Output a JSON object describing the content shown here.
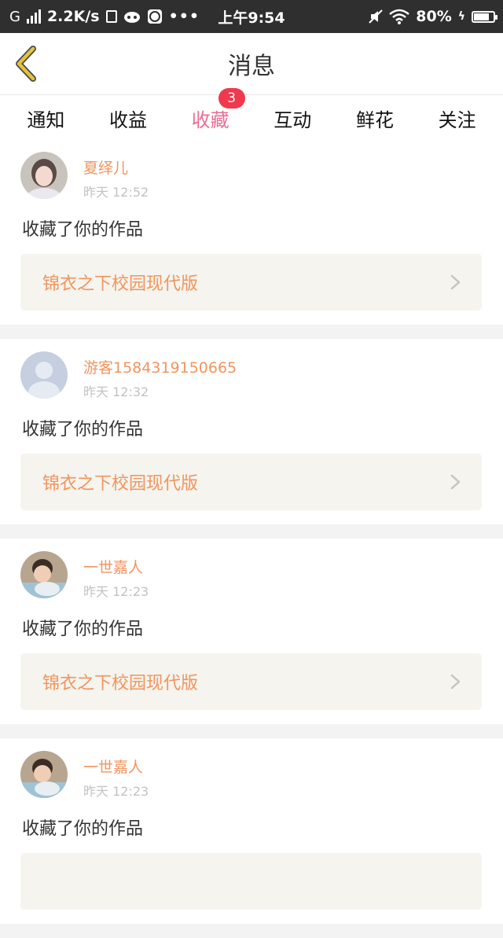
{
  "status_bar": {
    "network_type": "G",
    "speed": "2.2K/s",
    "time": "上午9:54",
    "battery": "80%",
    "battery_level": 0.8,
    "icons": [
      "signal-icon",
      "sim-icon",
      "cat-icon",
      "globe-icon",
      "more-icon",
      "mute-icon",
      "wifi-icon",
      "battery-icon"
    ]
  },
  "header": {
    "title": "消息",
    "back_icon": "chevron-left-icon",
    "accent": "#e6c23a"
  },
  "tabs": [
    {
      "label": "通知",
      "active": false
    },
    {
      "label": "收益",
      "active": false
    },
    {
      "label": "收藏",
      "active": true,
      "badge": "3"
    },
    {
      "label": "互动",
      "active": false
    },
    {
      "label": "鲜花",
      "active": false
    },
    {
      "label": "关注",
      "active": false
    }
  ],
  "colors": {
    "active_tab": "#ea6d94",
    "badge": "#f0394d",
    "username": "#f0955e",
    "work_title": "#f0955e",
    "work_box_bg": "#f5f4ee"
  },
  "feed": [
    {
      "username": "夏绎儿",
      "time": "昨天 12:52",
      "action": "收藏了你的作品",
      "work_title": "锦衣之下校园现代版",
      "avatar": "avatar-woman"
    },
    {
      "username": "游客1584319150665",
      "time": "昨天 12:32",
      "action": "收藏了你的作品",
      "work_title": "锦衣之下校园现代版",
      "avatar": "avatar-default"
    },
    {
      "username": "一世嘉人",
      "time": "昨天 12:23",
      "action": "收藏了你的作品",
      "work_title": "锦衣之下校园现代版",
      "avatar": "avatar-child"
    },
    {
      "username": "一世嘉人",
      "time": "昨天 12:23",
      "action": "收藏了你的作品",
      "work_title": "",
      "avatar": "avatar-child"
    }
  ]
}
